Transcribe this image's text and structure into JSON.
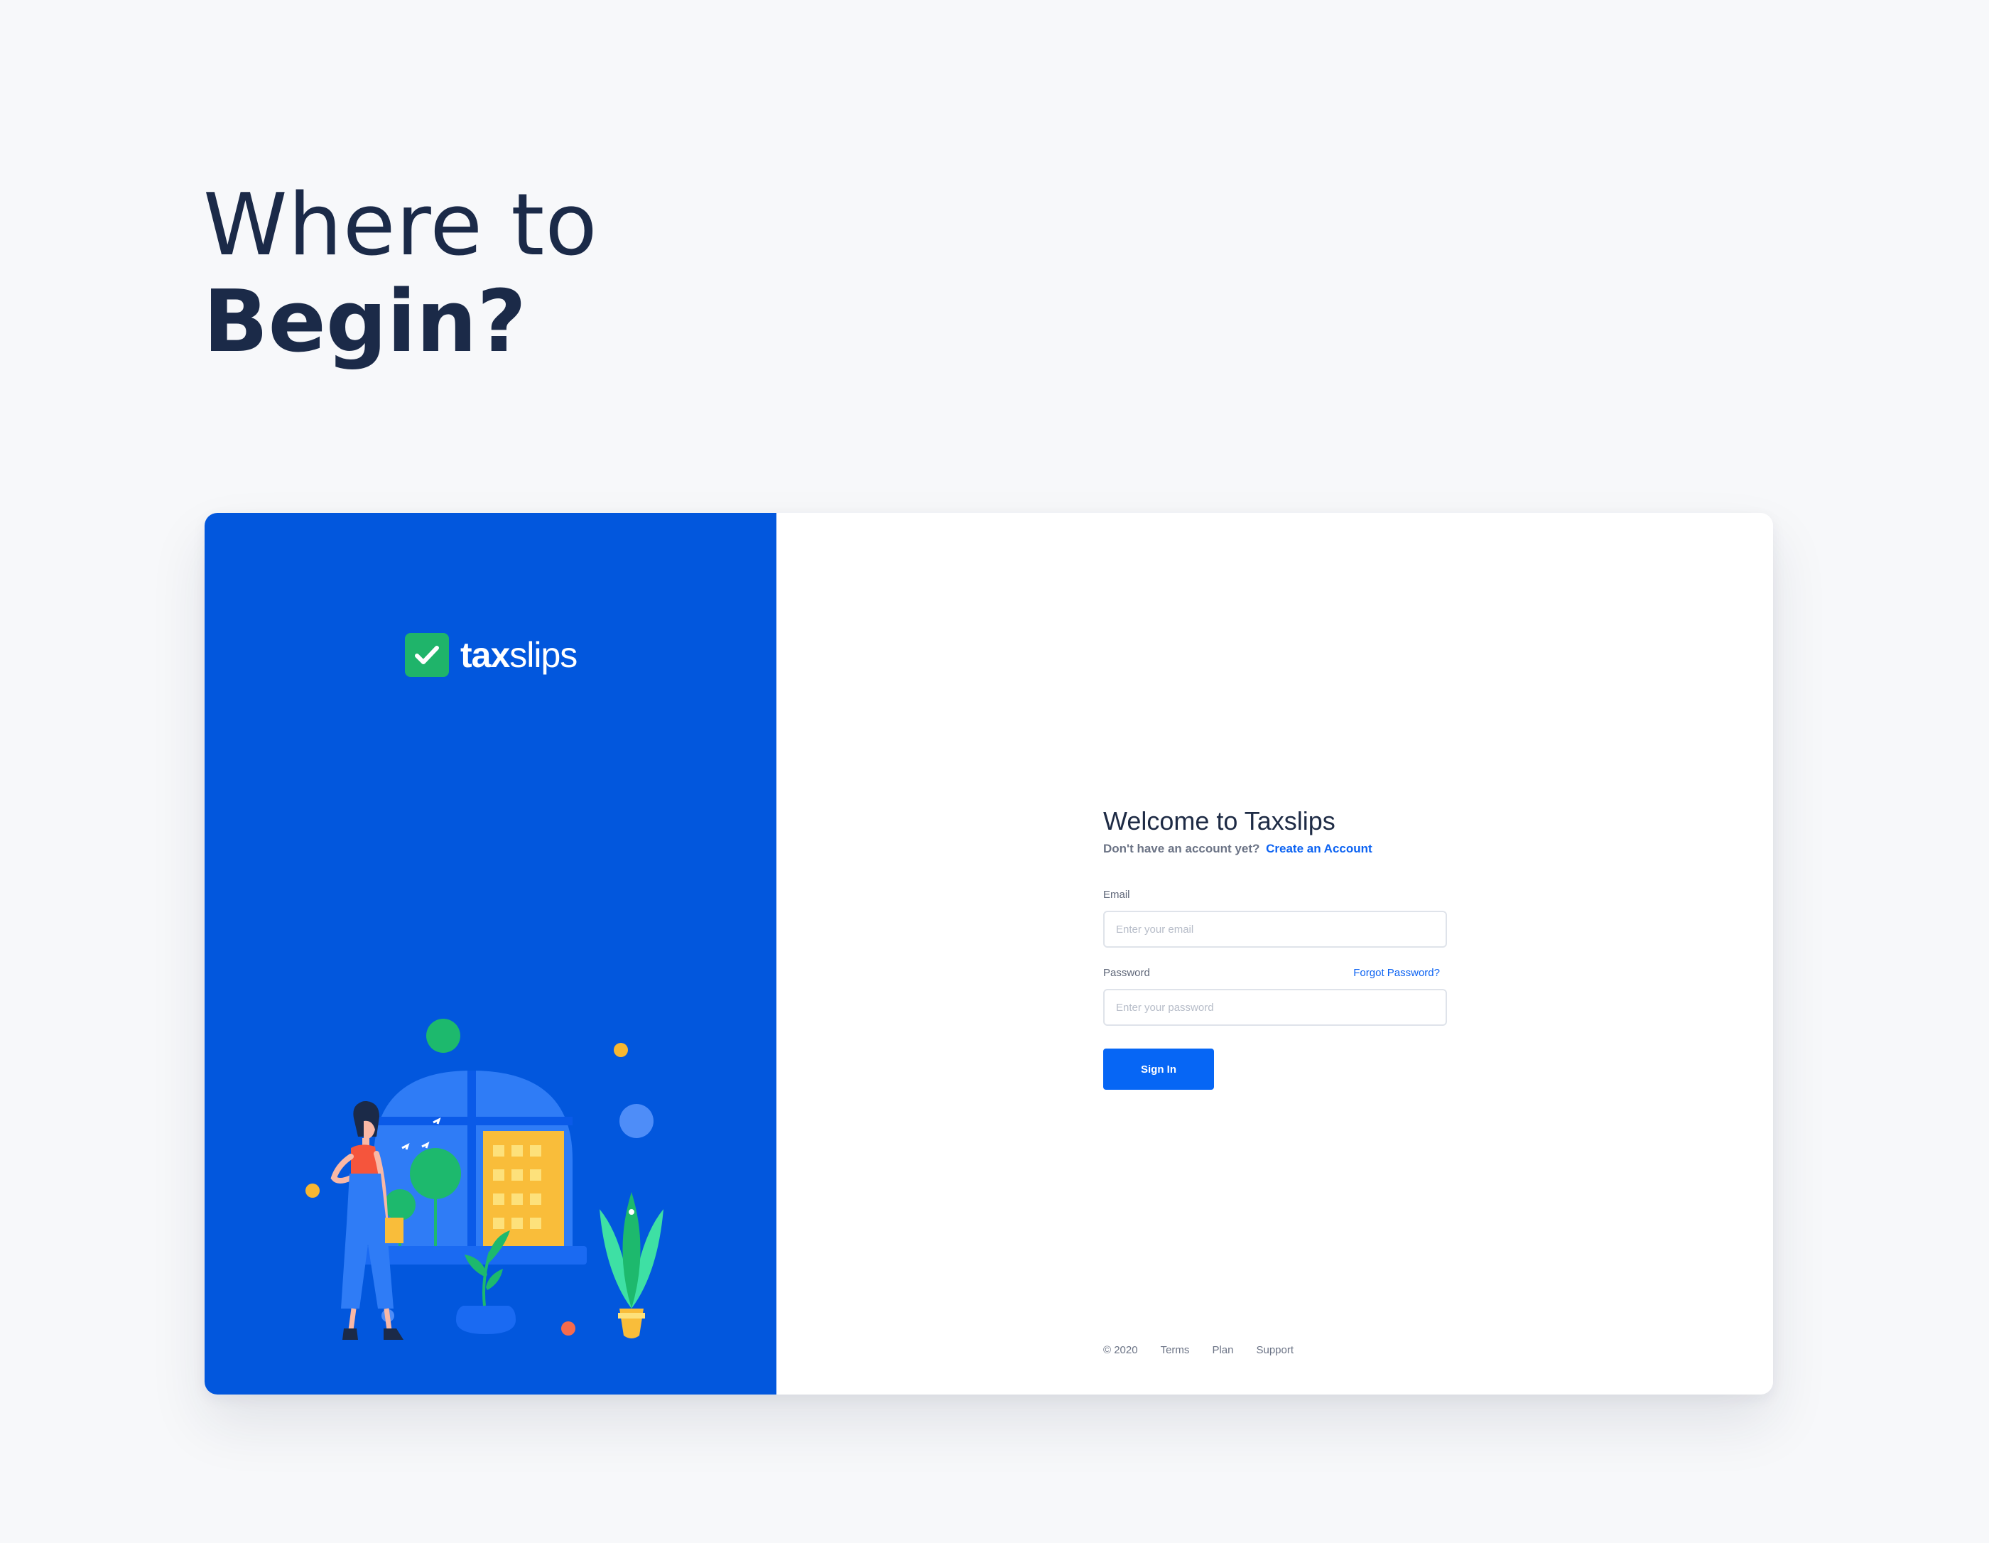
{
  "hero": {
    "line1": "Where to",
    "line2": "Begin?"
  },
  "brand": {
    "name_bold": "tax",
    "name_light": "slips",
    "logo_icon": "checkmark-badge-icon",
    "panel_color": "#0257dd",
    "badge_color": "#1fb46a"
  },
  "login": {
    "title": "Welcome to Taxslips",
    "signup_prompt": "Don't have an account yet?",
    "signup_link": "Create an Account",
    "email_label": "Email",
    "email_placeholder": "Enter your email",
    "password_label": "Password",
    "forgot_link": "Forgot Password?",
    "password_placeholder": "Enter your password",
    "submit_label": "Sign In",
    "accent_color": "#0666f5"
  },
  "footer": {
    "copyright": "© 2020",
    "links": [
      "Terms",
      "Plan",
      "Support"
    ]
  }
}
